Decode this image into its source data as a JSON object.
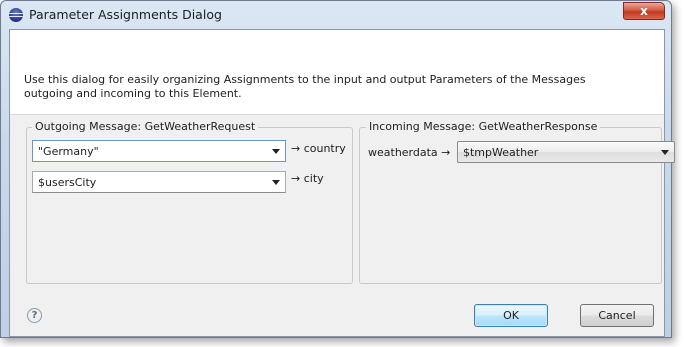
{
  "window": {
    "title": "Parameter Assignments Dialog",
    "close_glyph": "x"
  },
  "description": "Use this dialog for easily organizing Assignments to the input and output Parameters of the Messages outgoing and incoming to this Element.",
  "outgoing": {
    "title": "Outgoing Message: GetWeatherRequest",
    "rows": [
      {
        "value": "\"Germany\"",
        "target": "→ country"
      },
      {
        "value": "$usersCity",
        "target": "→ city"
      }
    ]
  },
  "incoming": {
    "title": "Incoming Message: GetWeatherResponse",
    "rows": [
      {
        "source": "weatherdata →",
        "value": "$tmpWeather"
      }
    ]
  },
  "buttons": {
    "help_glyph": "?",
    "ok": "OK",
    "cancel": "Cancel"
  },
  "icons": {
    "app": "eclipse-icon",
    "close": "close-icon",
    "help": "help-icon",
    "dropdown": "chevron-down-icon"
  }
}
